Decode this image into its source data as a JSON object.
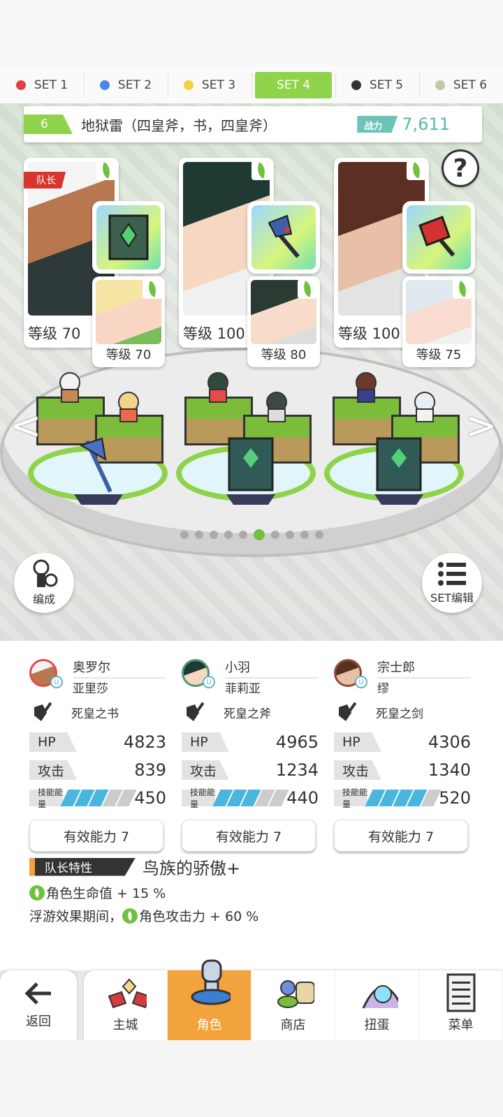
{
  "set_tabs": [
    {
      "label": "SET 1",
      "color": "#e0404a",
      "active": false
    },
    {
      "label": "SET 2",
      "color": "#4a86e8",
      "active": false
    },
    {
      "label": "SET 3",
      "color": "#f2d23c",
      "active": false
    },
    {
      "label": "SET 4",
      "color": "#8fd34a",
      "active": true
    },
    {
      "label": "SET 5",
      "color": "#333333",
      "active": false
    },
    {
      "label": "SET 6",
      "color": "#c6c9a5",
      "active": false
    }
  ],
  "team": {
    "number": "6",
    "name": "地狱雷（四皇斧，书，四皇斧）",
    "power_label": "战力",
    "power_value": "7,611"
  },
  "help_icon": "?",
  "nav_arrows": {
    "left": "<",
    "right": ">"
  },
  "slots": [
    {
      "leader_tag": "队长",
      "main_level": "等级 70",
      "sub_level": "等级 70",
      "equip_icon": "book-icon"
    },
    {
      "main_level": "等级 100",
      "sub_level": "等级 80",
      "equip_icon": "axe-icon"
    },
    {
      "main_level": "等级 100",
      "sub_level": "等级 75",
      "equip_icon": "cleaver-icon"
    }
  ],
  "page_dots": {
    "count": 10,
    "active": 5
  },
  "buttons": {
    "formation": "编成",
    "set_edit": "SET编辑"
  },
  "characters": [
    {
      "name": "奥罗尔",
      "partner": "亚里莎",
      "weapon": "死皇之书",
      "hp_label": "HP",
      "hp": "4823",
      "atk_label": "攻击",
      "atk": "839",
      "energy_label": "技能能量",
      "energy": "450",
      "ability": "有效能力 7"
    },
    {
      "name": "小羽",
      "partner": "菲莉亚",
      "weapon": "死皇之斧",
      "hp_label": "HP",
      "hp": "4965",
      "atk_label": "攻击",
      "atk": "1234",
      "energy_label": "技能能量",
      "energy": "440",
      "ability": "有效能力 7"
    },
    {
      "name": "宗士郎",
      "partner": "缪",
      "weapon": "死皇之剑",
      "hp_label": "HP",
      "hp": "4306",
      "atk_label": "攻击",
      "atk": "1340",
      "energy_label": "技能能量",
      "energy": "520",
      "ability": "有效能力 7"
    }
  ],
  "leader_trait": {
    "label": "队长特性",
    "skill": "鸟族的骄傲+",
    "line1": "角色生命值 + 15 %",
    "line2_prefix": "浮游效果期间，",
    "line2": "角色攻击力 + 60 %"
  },
  "bottom_nav": {
    "back": "返回",
    "items": [
      {
        "label": "主城",
        "icon": "castle-icon",
        "active": false
      },
      {
        "label": "角色",
        "icon": "character-icon",
        "active": true
      },
      {
        "label": "商店",
        "icon": "shop-icon",
        "active": false
      },
      {
        "label": "扭蛋",
        "icon": "gacha-icon",
        "active": false
      },
      {
        "label": "菜单",
        "icon": "menu-icon",
        "active": false
      }
    ]
  },
  "colors": {
    "accent_green": "#8fd34a",
    "accent_orange": "#f3a33c",
    "power_teal": "#57b8a8",
    "leader_red": "#d9352e"
  }
}
